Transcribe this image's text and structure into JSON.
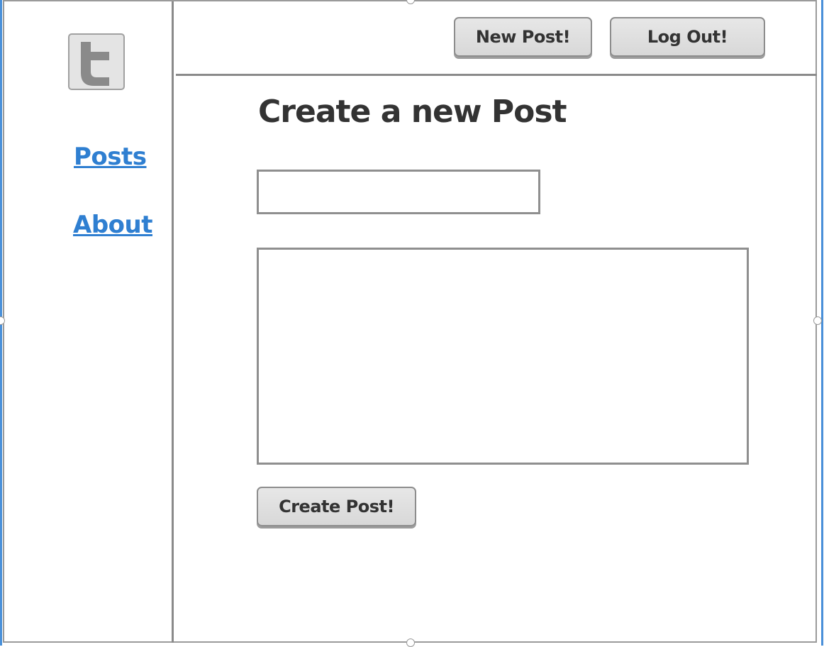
{
  "header": {
    "new_post_label": "New Post!",
    "logout_label": "Log Out!"
  },
  "sidebar": {
    "logo_icon": "twitter-t-icon",
    "items": [
      {
        "label": "Posts"
      },
      {
        "label": "About"
      }
    ]
  },
  "main": {
    "title": "Create a new Post",
    "title_field": {
      "value": "",
      "placeholder": ""
    },
    "body_field": {
      "value": "",
      "placeholder": ""
    },
    "submit_label": "Create Post!"
  },
  "colors": {
    "link": "#2f7fd1",
    "text": "#333333",
    "border": "#8f8f8f",
    "button_bg": "#dcdcdc"
  }
}
